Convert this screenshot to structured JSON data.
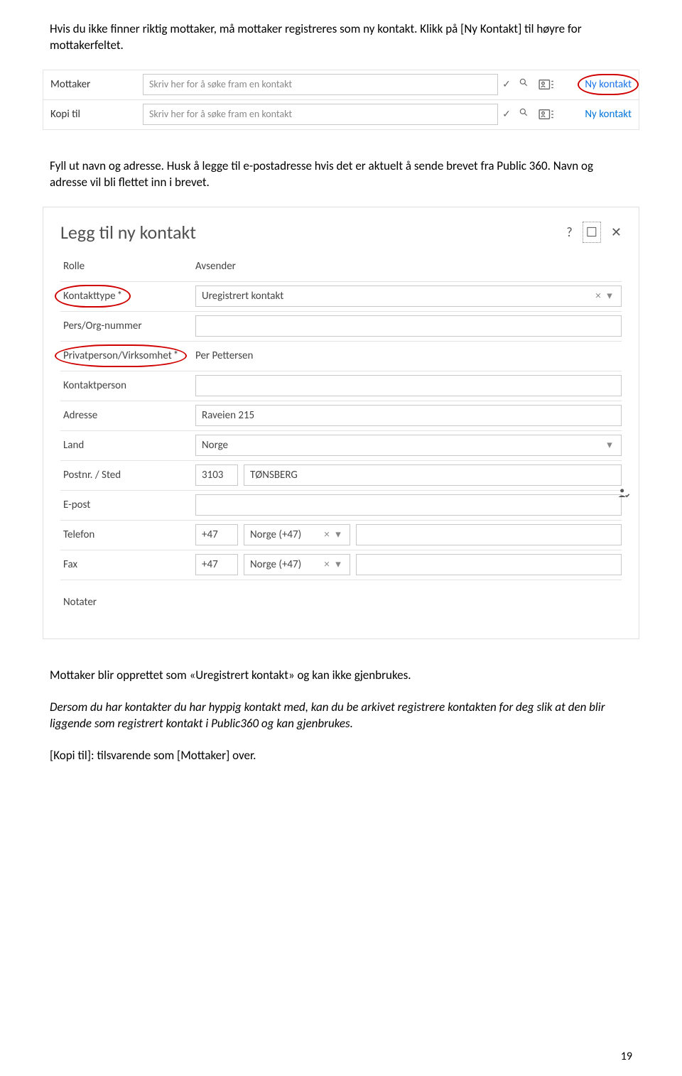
{
  "intro_text": "Hvis du ikke finner riktig mottaker, må mottaker registreres som ny kontakt. Klikk på [Ny Kontakt] til høyre for mottakerfeltet.",
  "screenshot1": {
    "rows": [
      {
        "label": "Mottaker",
        "placeholder": "Skriv her for å søke fram en kontakt",
        "newcontact": "Ny kontakt",
        "highlight": true
      },
      {
        "label": "Kopi til",
        "placeholder": "Skriv her for å søke fram en kontakt",
        "newcontact": "Ny kontakt",
        "highlight": false
      }
    ]
  },
  "mid_text": "Fyll ut navn og adresse. Husk å legge til e-postadresse hvis det er aktuelt å sende brevet fra Public 360. Navn og adresse vil bli flettet inn i brevet.",
  "screenshot2": {
    "title": "Legg til ny kontakt",
    "rows": {
      "rolle": {
        "label": "Rolle",
        "value": "Avsender"
      },
      "kontakttype": {
        "label": "Kontakttype",
        "star": "*",
        "value": "Uregistrert kontakt"
      },
      "persorg": {
        "label": "Pers/Org-nummer",
        "value": ""
      },
      "privat": {
        "label": "Privatperson/Virksomhet",
        "star": "*",
        "value": "Per Pettersen"
      },
      "kontaktperson": {
        "label": "Kontaktperson",
        "value": ""
      },
      "adresse": {
        "label": "Adresse",
        "value": "Raveien 215"
      },
      "land": {
        "label": "Land",
        "value": "Norge"
      },
      "postnr": {
        "label": "Postnr. / Sted",
        "nr": "3103",
        "sted": "TØNSBERG"
      },
      "epost": {
        "label": "E-post",
        "value": ""
      },
      "telefon": {
        "label": "Telefon",
        "prefix": "+47",
        "country": "Norge (+47)",
        "value": ""
      },
      "fax": {
        "label": "Fax",
        "prefix": "+47",
        "country": "Norge (+47)",
        "value": ""
      },
      "notater": {
        "label": "Notater",
        "value": ""
      }
    }
  },
  "after_text": "Mottaker blir opprettet som «Uregistrert kontakt» og kan ikke gjenbrukes.",
  "italic_text": "Dersom du har kontakter du har hyppig kontakt med, kan du be arkivet registrere kontakten for deg slik at den blir liggende som registrert kontakt i Public360 og kan gjenbrukes.",
  "last_text": "[Kopi til]: tilsvarende som [Mottaker] over.",
  "page_number": "19"
}
